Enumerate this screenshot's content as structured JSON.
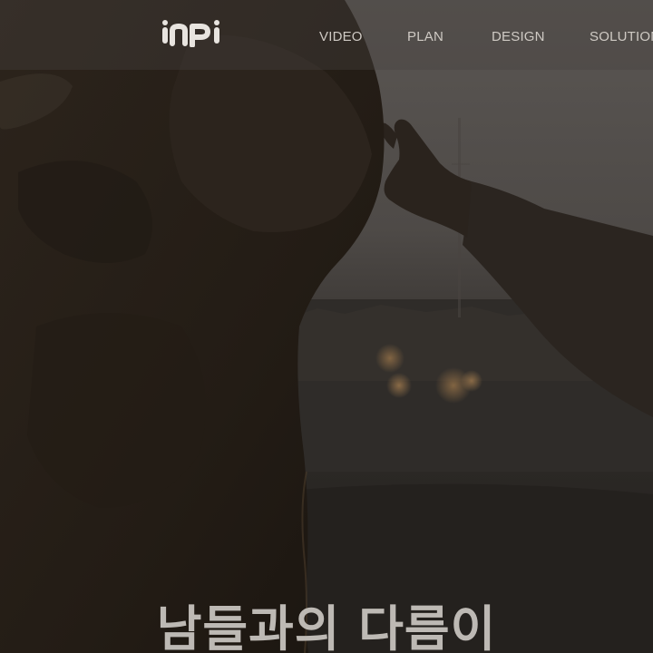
{
  "brand": {
    "logo_text": "inpi"
  },
  "nav": {
    "items": [
      {
        "label": "VIDEO"
      },
      {
        "label": "PLAN"
      },
      {
        "label": "DESIGN"
      },
      {
        "label": "SOLUTION"
      }
    ]
  },
  "hero": {
    "headline": "남들과의 다름이"
  },
  "colors": {
    "nav_text": "#cfcac4",
    "headline_text": "#bdb9b4",
    "topbar_bg": "#46423e"
  }
}
